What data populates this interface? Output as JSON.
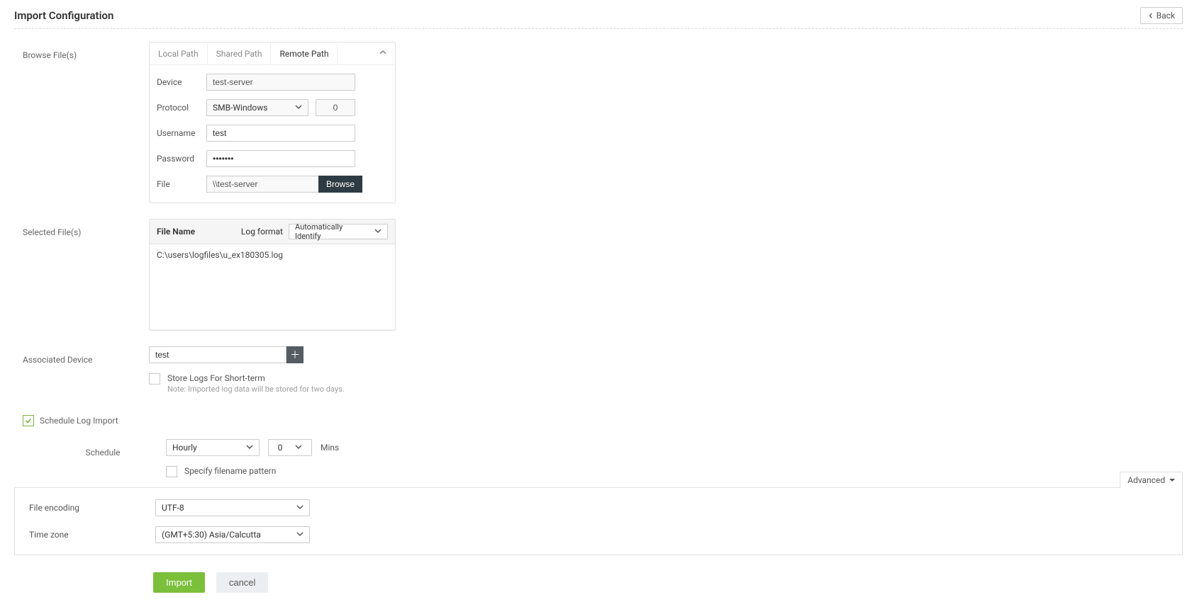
{
  "header": {
    "title": "Import Configuration",
    "back": "Back"
  },
  "browse": {
    "label": "Browse File(s)",
    "tabs": {
      "local": "Local Path",
      "shared": "Shared Path",
      "remote": "Remote Path"
    },
    "fields": {
      "device_label": "Device",
      "device_value": "test-server",
      "protocol_label": "Protocol",
      "protocol_value": "SMB-Windows",
      "protocol_port": "0",
      "username_label": "Username",
      "username_value": "test",
      "password_label": "Password",
      "password_value": "•••••••",
      "file_label": "File",
      "file_value": "\\\\test-server",
      "browse_btn": "Browse"
    }
  },
  "selected": {
    "label": "Selected File(s)",
    "file_name_label": "File Name",
    "log_format_label": "Log format",
    "log_format_value": "Automatically Identify",
    "files": [
      "C:\\users\\logfiles\\u_ex180305.log"
    ]
  },
  "associated": {
    "label": "Associated Device",
    "value": "test",
    "store_logs_label": "Store Logs For Short-term",
    "store_logs_note": "Note: Imported log data will be stored for two days."
  },
  "schedule": {
    "enable_label": "Schedule Log Import",
    "schedule_label": "Schedule",
    "freq_value": "Hourly",
    "min_value": "0",
    "mins_label": "Mins",
    "pattern_label": "Specify filename pattern"
  },
  "advanced": {
    "tab_label": "Advanced",
    "encoding_label": "File encoding",
    "encoding_value": "UTF-8",
    "timezone_label": "Time zone",
    "timezone_value": "(GMT+5:30) Asia/Calcutta"
  },
  "footer": {
    "import": "Import",
    "cancel": "cancel"
  }
}
